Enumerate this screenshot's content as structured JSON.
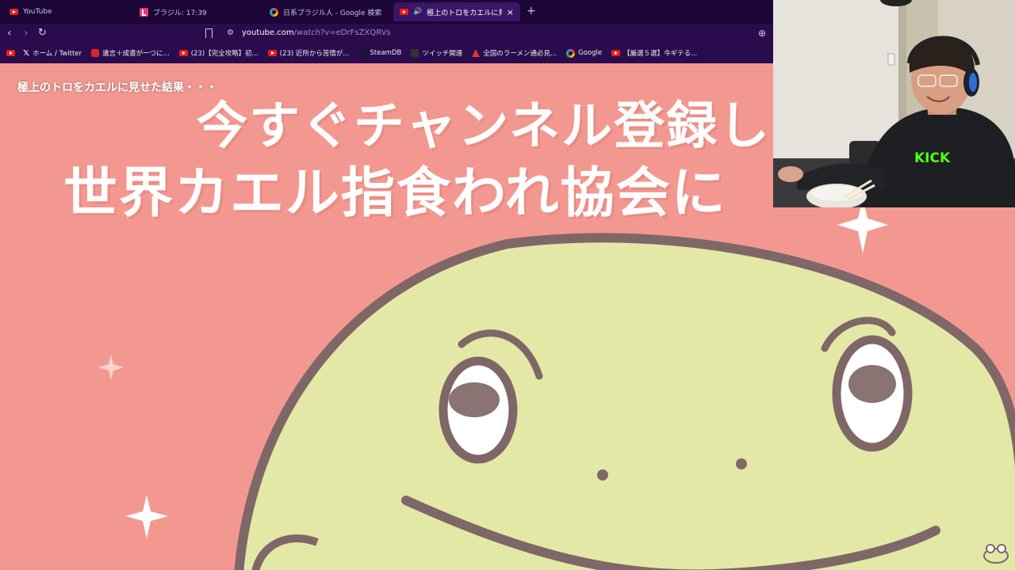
{
  "tabs": [
    {
      "title": "YouTube",
      "icon": "youtube-icon"
    },
    {
      "title": "ブラジル: 17:39",
      "icon": "l-app-icon"
    },
    {
      "title": "日系ブラジル人 - Google 検索",
      "icon": "google-icon"
    },
    {
      "title": "極上のトロをカエルに見せた結果",
      "icon": "youtube-icon",
      "active": true
    }
  ],
  "new_tab_glyph": "+",
  "close_glyph": "×",
  "address": {
    "host": "youtube.com",
    "path": "/watch?v=eDrFsZXQRVs"
  },
  "bookmarks": [
    {
      "label": "",
      "icon": "youtube-icon"
    },
    {
      "label": "ホーム / Twitter",
      "icon": "x-icon"
    },
    {
      "label": "遺言＋成書が一つに...",
      "icon": "red-square-icon"
    },
    {
      "label": "(23)【完全攻略】初...",
      "icon": "youtube-icon"
    },
    {
      "label": "(23) 近所から苦情が...",
      "icon": "youtube-icon"
    },
    {
      "label": "SteamDB",
      "icon": "steam-icon"
    },
    {
      "label": "ツイッチ関連",
      "icon": "twitch-icon"
    },
    {
      "label": "全国のラーメン通必見...",
      "icon": "ramen-icon"
    },
    {
      "label": "Google",
      "icon": "google-icon"
    },
    {
      "label": "【厳選５選】今ギテる...",
      "icon": "youtube-icon"
    }
  ],
  "video": {
    "title": "極上のトロをカエルに見せた結果・・・",
    "caption_line1": "今すぐチャンネル登録し",
    "caption_line2": "世界カエル指食われ協会に",
    "background_color": "#f39891",
    "frog_color": "#e3e8a6",
    "outline_color": "#7f6767"
  },
  "webcam": {
    "shirt_logo": "KICK"
  }
}
